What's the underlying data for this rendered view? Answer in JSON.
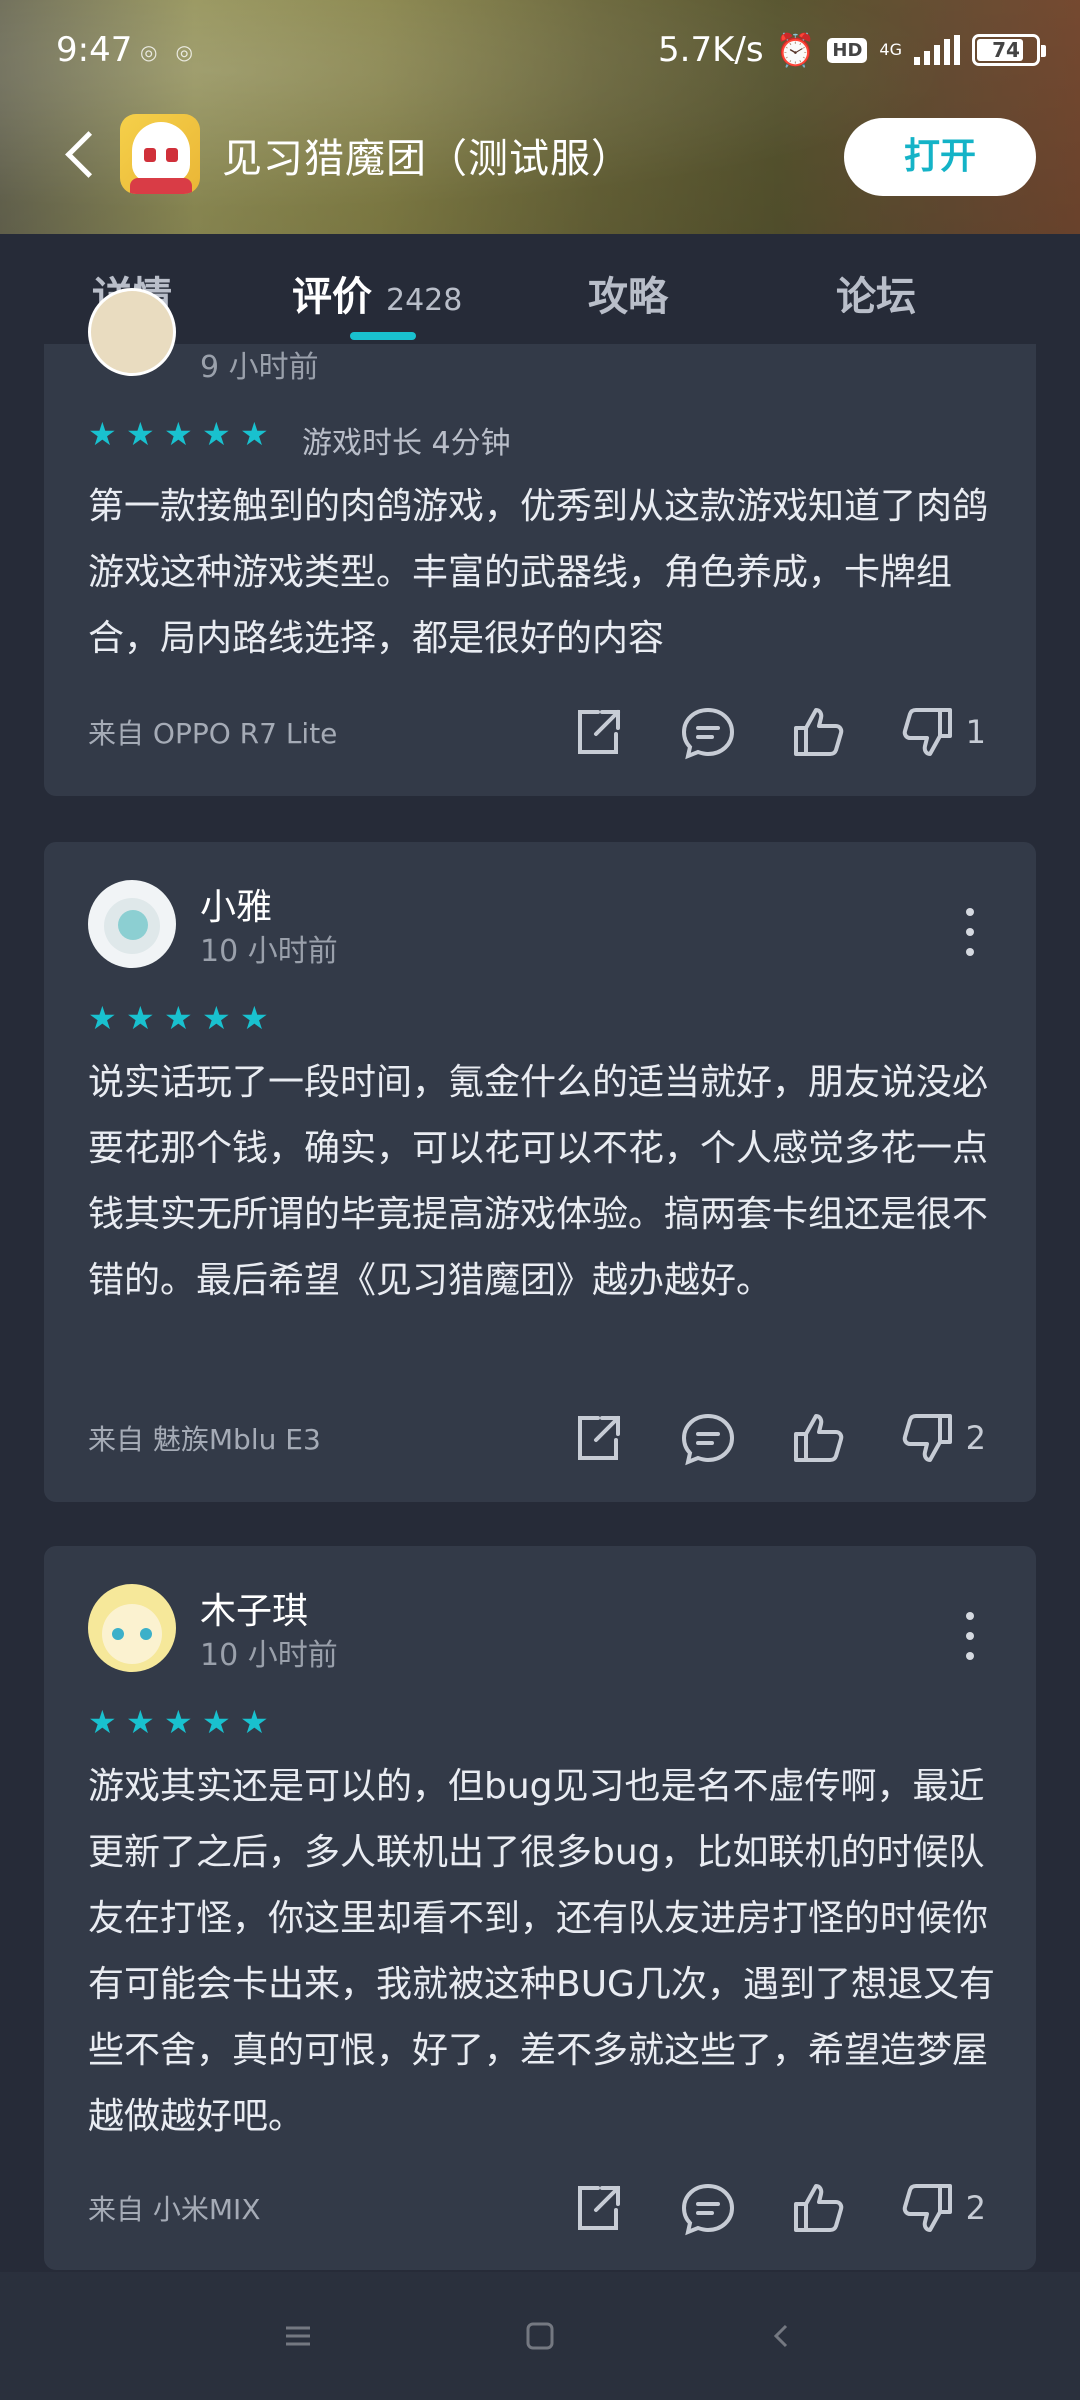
{
  "status_bar": {
    "time": "9:47",
    "speed": "5.7K/s",
    "hd": "HD",
    "network": "4G",
    "battery": "74"
  },
  "header": {
    "app_title": "见习猎魔团（测试服）",
    "open_label": "打开"
  },
  "tabs": [
    {
      "label": "详情"
    },
    {
      "label": "评价",
      "count": "2428"
    },
    {
      "label": "攻略"
    },
    {
      "label": "论坛"
    }
  ],
  "reviews": [
    {
      "time": "9 小时前",
      "stars": 5,
      "play_time": "游戏时长 4分钟",
      "text": "第一款接触到的肉鸽游戏，优秀到从这款游戏知道了肉鸽游戏这种游戏类型。丰富的武器线，角色养成，卡牌组合，局内路线选择，都是很好的内容",
      "device": "来自 OPPO R7 Lite",
      "dislikes": "1"
    },
    {
      "username": "小雅",
      "time": "10 小时前",
      "stars": 5,
      "text": "说实话玩了一段时间，氪金什么的适当就好，朋友说没必要花那个钱，确实，可以花可以不花，个人感觉多花一点钱其实无所谓的毕竟提高游戏体验。搞两套卡组还是很不错的。最后希望《见习猎魔团》越办越好。",
      "device": "来自 魅族Mblu E3",
      "dislikes": "2"
    },
    {
      "username": "木子琪",
      "time": "10 小时前",
      "stars": 5,
      "text": "游戏其实还是可以的，但bug见习也是名不虚传啊，最近更新了之后，多人联机出了很多bug，比如联机的时候队友在打怪，你这里却看不到，还有队友进房打怪的时候你有可能会卡出来，我就被这种BUG几次，遇到了想退又有些不舍，真的可恨，好了，差不多就这些了，希望造梦屋越做越好吧。",
      "device": "来自 小米MIX",
      "dislikes": "2"
    }
  ],
  "colors": {
    "accent": "#19c1cf",
    "background": "#262b38",
    "card": "#333a48"
  }
}
